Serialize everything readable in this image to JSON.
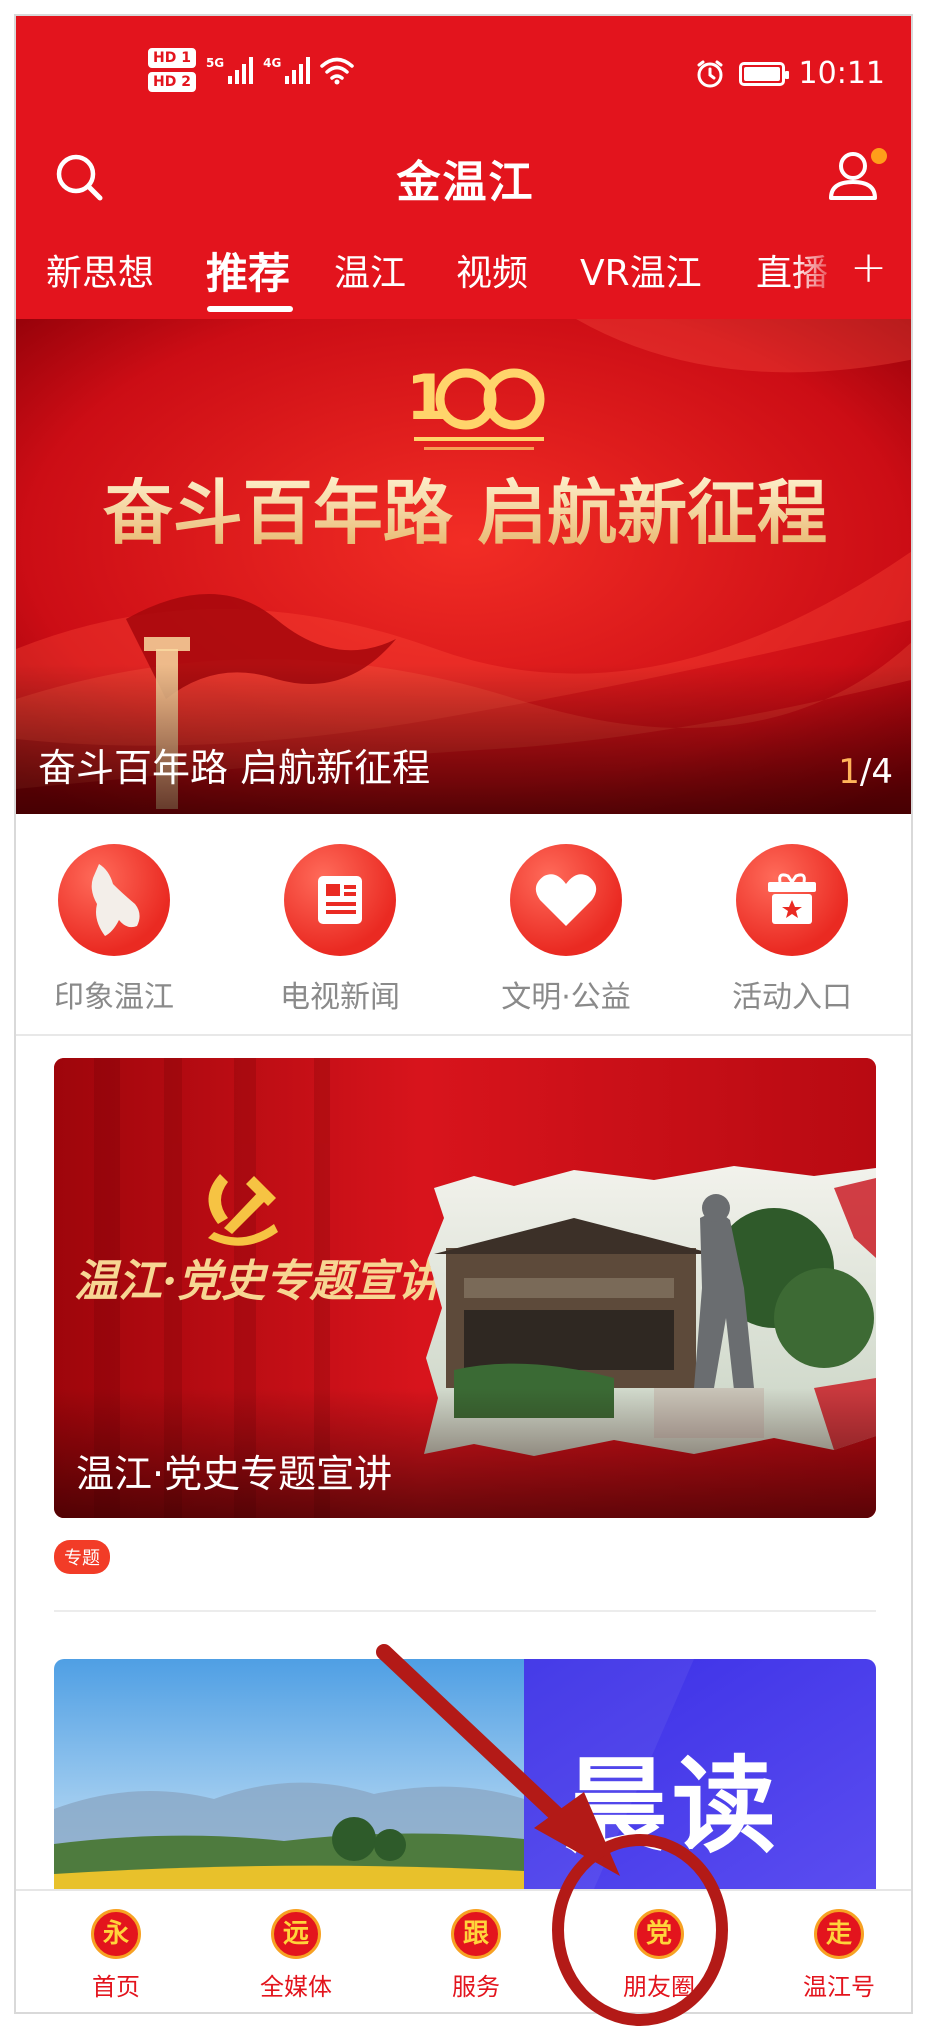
{
  "status": {
    "sim1": "HD 1",
    "sim2": "HD 2",
    "net1": "5G",
    "net2": "4G",
    "time": "10:11"
  },
  "header": {
    "title": "金温江",
    "icons": {
      "search": "search-icon",
      "user": "user-icon"
    }
  },
  "tabs": [
    {
      "label": "新思想"
    },
    {
      "label": "推荐",
      "active": true
    },
    {
      "label": "温江"
    },
    {
      "label": "视频"
    },
    {
      "label": "VR温江"
    },
    {
      "label": "直播"
    }
  ],
  "tabs_more": "+",
  "banner": {
    "caption": "奋斗百年路 启航新征程",
    "artwork_text": "奋斗百年路 启航新征程",
    "page_current": "1",
    "page_total": "/4"
  },
  "quick_links": [
    {
      "label": "印象温江",
      "icon": "map-icon"
    },
    {
      "label": "电视新闻",
      "icon": "newspaper-icon"
    },
    {
      "label": "文明·公益",
      "icon": "heart-icon"
    },
    {
      "label": "活动入口",
      "icon": "gift-icon"
    }
  ],
  "articles": [
    {
      "title": "温江·党史专题宣讲",
      "artwork_text": "温江·党史专题宣讲",
      "tag": "专题"
    },
    {
      "artwork_text": "晨读"
    }
  ],
  "bottom_nav": [
    {
      "badge": "永",
      "label": "首页"
    },
    {
      "badge": "远",
      "label": "全媒体"
    },
    {
      "badge": "跟",
      "label": "服务"
    },
    {
      "badge": "党",
      "label": "朋友圈"
    },
    {
      "badge": "走",
      "label": "温江号"
    }
  ],
  "colors": {
    "brand_red": "#e3141d",
    "accent_orange": "#f7a223",
    "annotation_red": "#b31a17"
  }
}
